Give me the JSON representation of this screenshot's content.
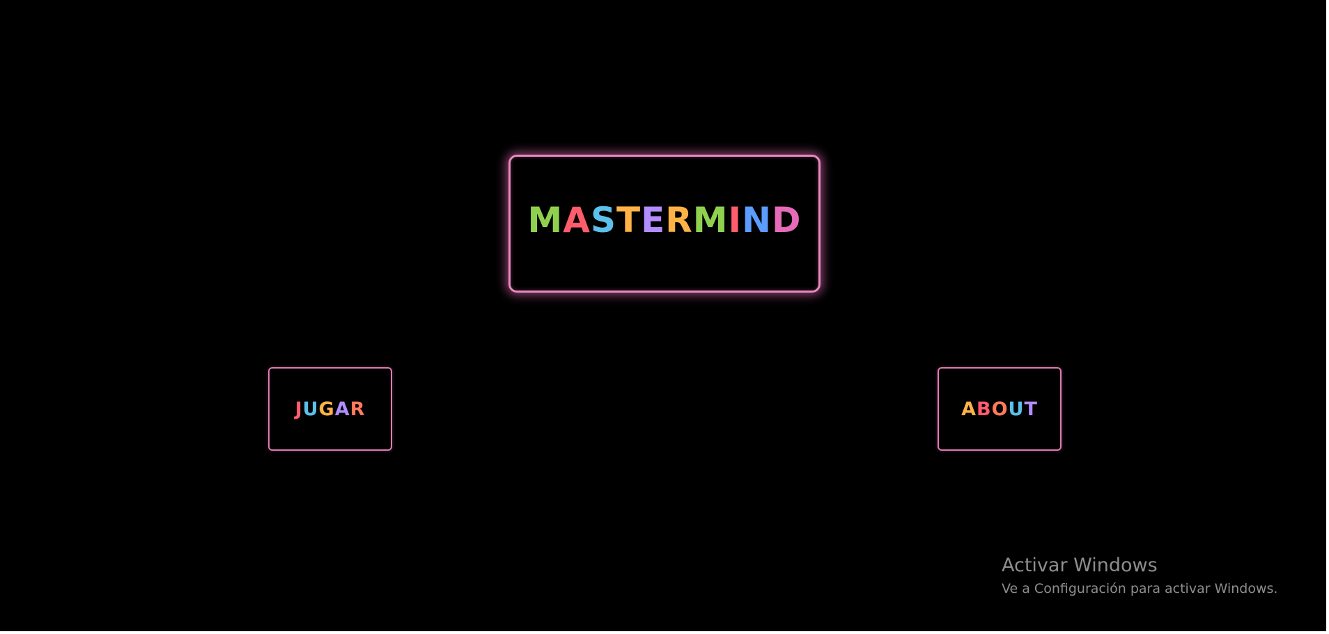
{
  "title": {
    "letters": [
      "M",
      "A",
      "S",
      "T",
      "E",
      "R",
      "M",
      "I",
      "N",
      "D"
    ],
    "colors": [
      "#8fd14f",
      "#ff5c6c",
      "#5bc0eb",
      "#ffb347",
      "#b28dff",
      "#ffb347",
      "#8fd14f",
      "#ff5c6c",
      "#5b9cff",
      "#e56bb8"
    ]
  },
  "buttons": {
    "jugar": {
      "letters": [
        "J",
        "U",
        "G",
        "A",
        "R"
      ],
      "colors": [
        "#ff5c6c",
        "#5bc0eb",
        "#ffb347",
        "#b28dff",
        "#ff7b5c"
      ]
    },
    "about": {
      "letters": [
        "A",
        "B",
        "O",
        "U",
        "T"
      ],
      "colors": [
        "#ffb347",
        "#ff5c6c",
        "#ff7b5c",
        "#5bc0eb",
        "#b28dff"
      ]
    }
  },
  "watermark": {
    "title": "Activar Windows",
    "subtitle": "Ve a Configuración para activar Windows."
  },
  "colors": {
    "background": "#000000",
    "border_pink": "#e88ac0",
    "watermark_text": "#8d8d8d"
  }
}
